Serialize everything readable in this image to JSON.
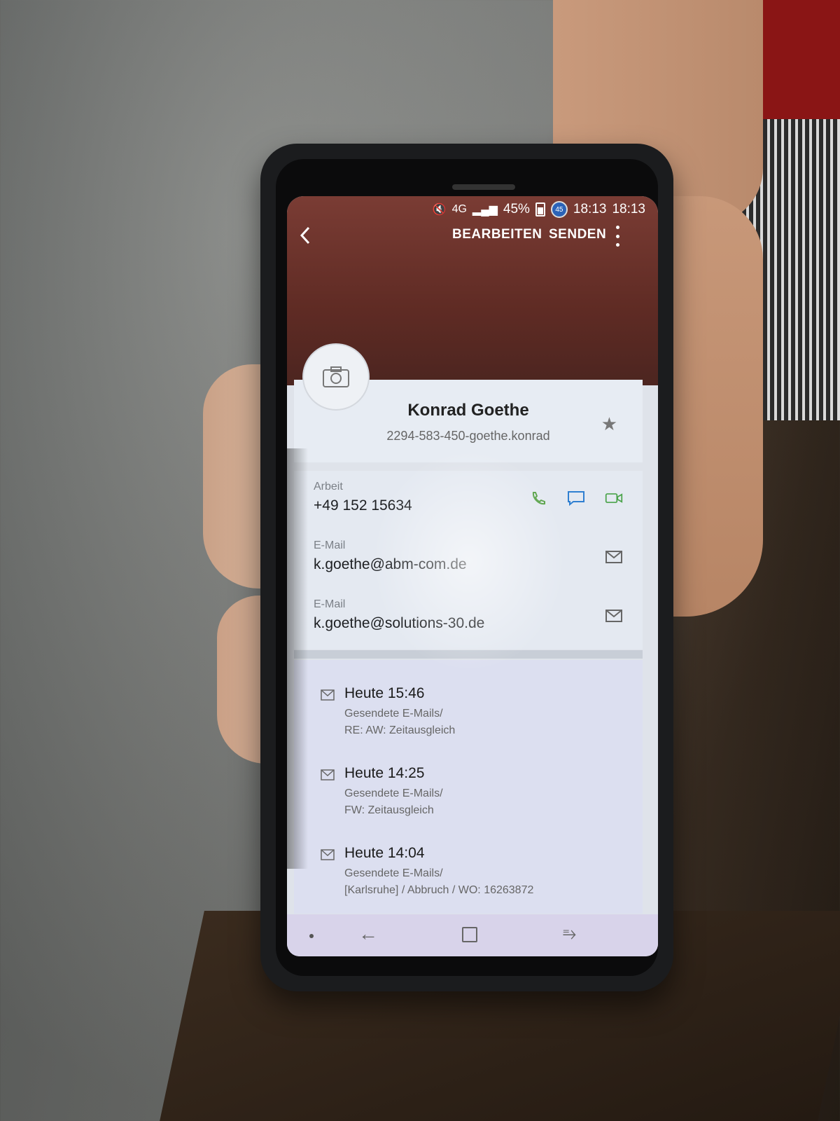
{
  "statusbar": {
    "battery": "45%",
    "badge": "45",
    "time_1": "18:13",
    "time_2": "18:13",
    "network": "4G"
  },
  "toolbar": {
    "edit_label": "BEARBEITEN",
    "send_label": "SENDEN"
  },
  "contact": {
    "name": "Konrad Goethe",
    "subtitle": "2294-583-450-goethe.konrad"
  },
  "fields": [
    {
      "label": "Arbeit",
      "value": "+49 152  15634"
    },
    {
      "label": "E-Mail",
      "value": "k.goethe@abm-com.de"
    },
    {
      "label": "E-Mail",
      "value": "k.goethe@solutions-30.de"
    }
  ],
  "history": [
    {
      "time": "Heute 15:46",
      "folder": "Gesendete E-Mails/",
      "subject": "RE: AW: Zeitausgleich"
    },
    {
      "time": "Heute 14:25",
      "folder": "Gesendete E-Mails/",
      "subject": "FW: Zeitausgleich"
    },
    {
      "time": "Heute 14:04",
      "folder": "Gesendete E-Mails/",
      "subject": "[Karlsruhe] / Abbruch / WO: 16263872"
    }
  ],
  "colors": {
    "header": "#6a3129",
    "call_icon": "#5aa34a",
    "message_icon": "#2f7fd1",
    "video_icon": "#4aa34a"
  }
}
